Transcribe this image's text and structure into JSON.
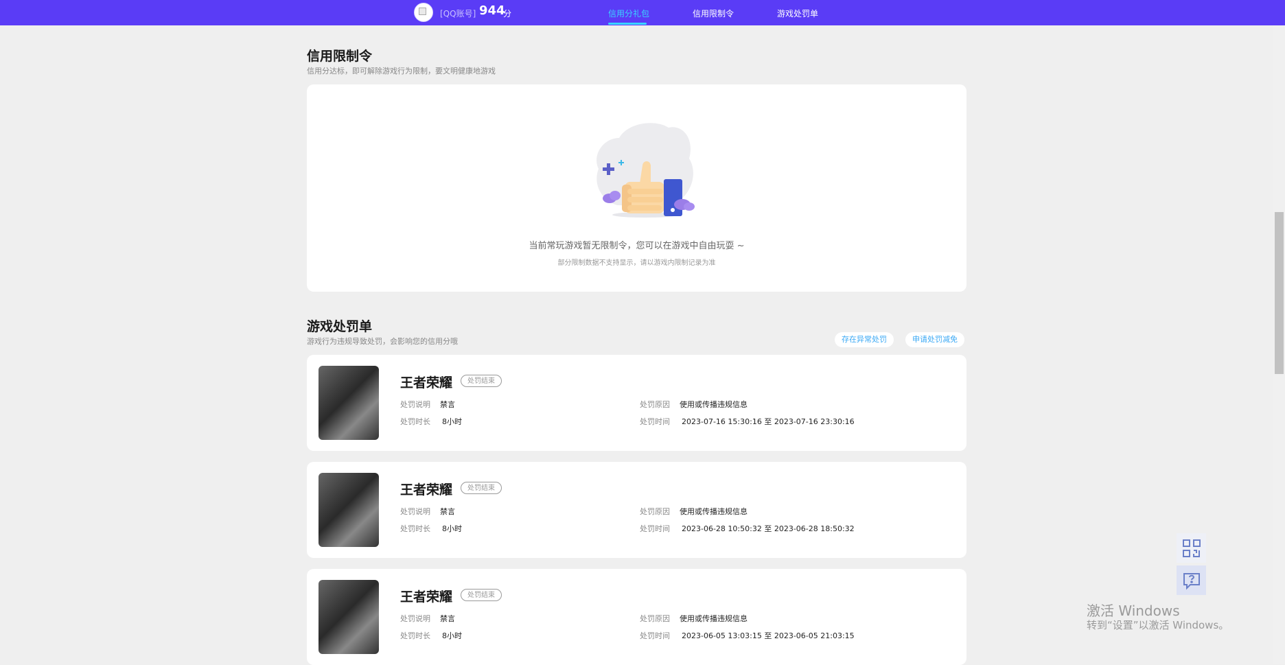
{
  "header": {
    "account_label": "[QQ账号]",
    "score": "944",
    "score_unit": "分",
    "tabs": [
      {
        "label": "信用分礼包",
        "active": true
      },
      {
        "label": "信用限制令",
        "active": false
      },
      {
        "label": "游戏处罚单",
        "active": false
      }
    ]
  },
  "restriction": {
    "title": "信用限制令",
    "subtitle": "信用分达标，即可解除游戏行为限制，要文明健康地游戏",
    "empty_illustration": "thumbs-up-icon",
    "empty_text": "当前常玩游戏暂无限制令，您可以在游戏中自由玩耍 ~",
    "empty_note": "部分限制数据不支持显示，请以游戏内限制记录为准"
  },
  "penalty": {
    "title": "游戏处罚单",
    "subtitle": "游戏行为违规导致处罚，会影响您的信用分哦",
    "btn_abnormal": "存在异常处罚",
    "btn_reduce": "申请处罚减免",
    "labels": {
      "desc": "处罚说明",
      "duration": "处罚时长",
      "reason": "处罚原因",
      "time": "处罚时间"
    },
    "items": [
      {
        "game": "王者荣耀",
        "status": "处罚结束",
        "desc": "禁言",
        "duration": "8小时",
        "reason": "使用或传播违规信息",
        "time": "2023-07-16 15:30:16 至 2023-07-16 23:30:16"
      },
      {
        "game": "王者荣耀",
        "status": "处罚结束",
        "desc": "禁言",
        "duration": "8小时",
        "reason": "使用或传播违规信息",
        "time": "2023-06-28 10:50:32 至 2023-06-28 18:50:32"
      },
      {
        "game": "王者荣耀",
        "status": "处罚结束",
        "desc": "禁言",
        "duration": "8小时",
        "reason": "使用或传播违规信息",
        "time": "2023-06-05 13:03:15 至 2023-06-05 21:03:15"
      }
    ]
  },
  "float_buttons": {
    "qr": "qr-code-icon",
    "help": "help-chat-icon"
  },
  "watermark": {
    "line1": "激活 Windows",
    "line2": "转到“设置”以激活 Windows。"
  },
  "colors": {
    "nav_bg": "#5a3cf6",
    "accent": "#39d4ff",
    "link": "#3ba9f5"
  }
}
